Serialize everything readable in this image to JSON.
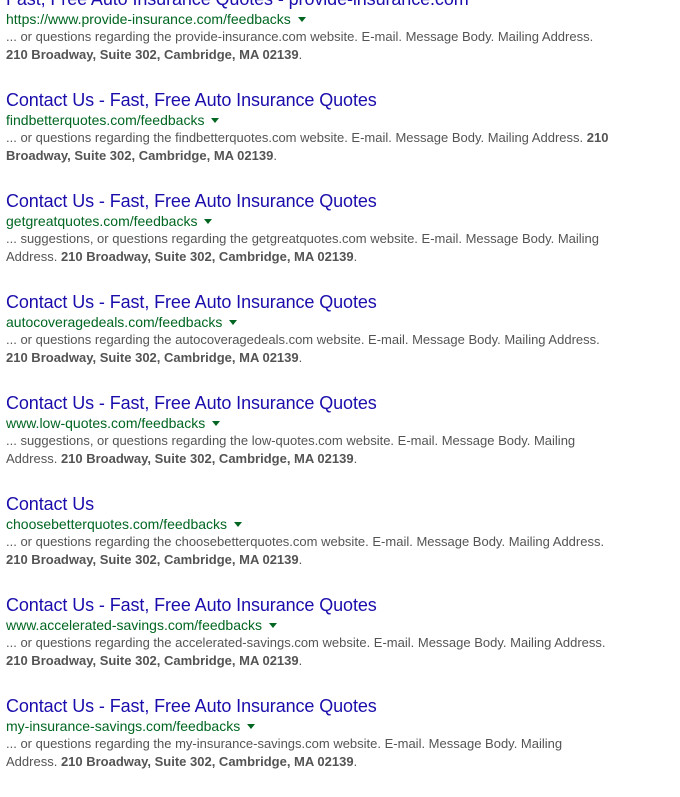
{
  "results": [
    {
      "title": "Fast, Free Auto Insurance Quotes - provide-insurance.com",
      "url": "https://www.provide-insurance.com/feedbacks",
      "snippet": "... or questions regarding the provide-insurance.com website. E-mail. Message Body. Mailing Address.",
      "address": "210 Broadway, Suite 302, Cambridge, MA 02139",
      "end": "."
    },
    {
      "title": "Contact Us - Fast, Free Auto Insurance Quotes",
      "url": "findbetterquotes.com/feedbacks",
      "snippet": "... or questions regarding the findbetterquotes.com website. E-mail. Message Body. Mailing Address.",
      "address": "210 Broadway, Suite 302, Cambridge, MA 02139",
      "end": "."
    },
    {
      "title": "Contact Us - Fast, Free Auto Insurance Quotes",
      "url": "getgreatquotes.com/feedbacks",
      "snippet": "... suggestions, or questions regarding the getgreatquotes.com website. E-mail. Message Body. Mailing Address.",
      "address": "210 Broadway, Suite 302, Cambridge, MA 02139",
      "end": "."
    },
    {
      "title": "Contact Us - Fast, Free Auto Insurance Quotes",
      "url": "autocoveragedeals.com/feedbacks",
      "snippet": "... or questions regarding the autocoveragedeals.com website. E-mail. Message Body. Mailing Address.",
      "address": "210 Broadway, Suite 302, Cambridge, MA 02139",
      "end": "."
    },
    {
      "title": "Contact Us - Fast, Free Auto Insurance Quotes",
      "url": "www.low-quotes.com/feedbacks",
      "snippet": "... suggestions, or questions regarding the low-quotes.com website. E-mail. Message Body. Mailing Address.",
      "address": "210 Broadway, Suite 302, Cambridge, MA 02139",
      "end": "."
    },
    {
      "title": "Contact Us",
      "url": "choosebetterquotes.com/feedbacks",
      "snippet": "... or questions regarding the choosebetterquotes.com website. E-mail. Message Body. Mailing Address.",
      "address": "210 Broadway, Suite 302, Cambridge, MA 02139",
      "end": "."
    },
    {
      "title": "Contact Us - Fast, Free Auto Insurance Quotes",
      "url": "www.accelerated-savings.com/feedbacks",
      "snippet": "... or questions regarding the accelerated-savings.com website. E-mail. Message Body. Mailing Address.",
      "address": "210 Broadway, Suite 302, Cambridge, MA 02139",
      "end": "."
    },
    {
      "title": "Contact Us - Fast, Free Auto Insurance Quotes",
      "url": "my-insurance-savings.com/feedbacks",
      "snippet": "... or questions regarding the my-insurance-savings.com website. E-mail. Message Body. Mailing Address.",
      "address": "210 Broadway, Suite 302, Cambridge, MA 02139",
      "end": "."
    }
  ],
  "colors": {
    "title_link": "#1a0dab",
    "url": "#006621",
    "snippet": "#545454",
    "background": "#ffffff"
  },
  "icons": {
    "url_menu": "chevron-down-icon"
  }
}
